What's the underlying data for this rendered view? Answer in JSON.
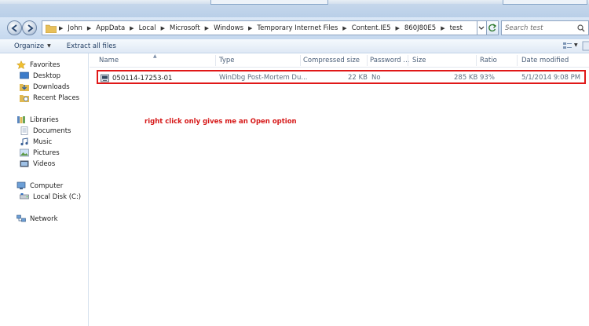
{
  "address_bar": {
    "crumbs": [
      "John",
      "AppData",
      "Local",
      "Microsoft",
      "Windows",
      "Temporary Internet Files",
      "Content.IE5",
      "860J80E5",
      "test"
    ]
  },
  "search": {
    "placeholder": "Search test"
  },
  "toolbar": {
    "organize_label": "Organize",
    "extract_label": "Extract all files"
  },
  "nav": {
    "favorites": {
      "label": "Favorites",
      "items": [
        "Desktop",
        "Downloads",
        "Recent Places"
      ]
    },
    "libraries": {
      "label": "Libraries",
      "items": [
        "Documents",
        "Music",
        "Pictures",
        "Videos"
      ]
    },
    "computer": {
      "label": "Computer",
      "items": [
        "Local Disk (C:)"
      ]
    },
    "network": {
      "label": "Network"
    }
  },
  "columns": [
    "Name",
    "Type",
    "Compressed size",
    "Password ...",
    "Size",
    "Ratio",
    "Date modified"
  ],
  "files": [
    {
      "name": "050114-17253-01",
      "type": "WinDbg Post-Mortem Du...",
      "compressed": "22 KB",
      "password": "No",
      "size": "285 KB",
      "ratio": "93%",
      "date": "5/1/2014 9:08 PM"
    }
  ],
  "annotation": "right click only gives me an Open option",
  "colors": {
    "highlight_border": "#e01818",
    "annotation_text": "#d61818"
  }
}
